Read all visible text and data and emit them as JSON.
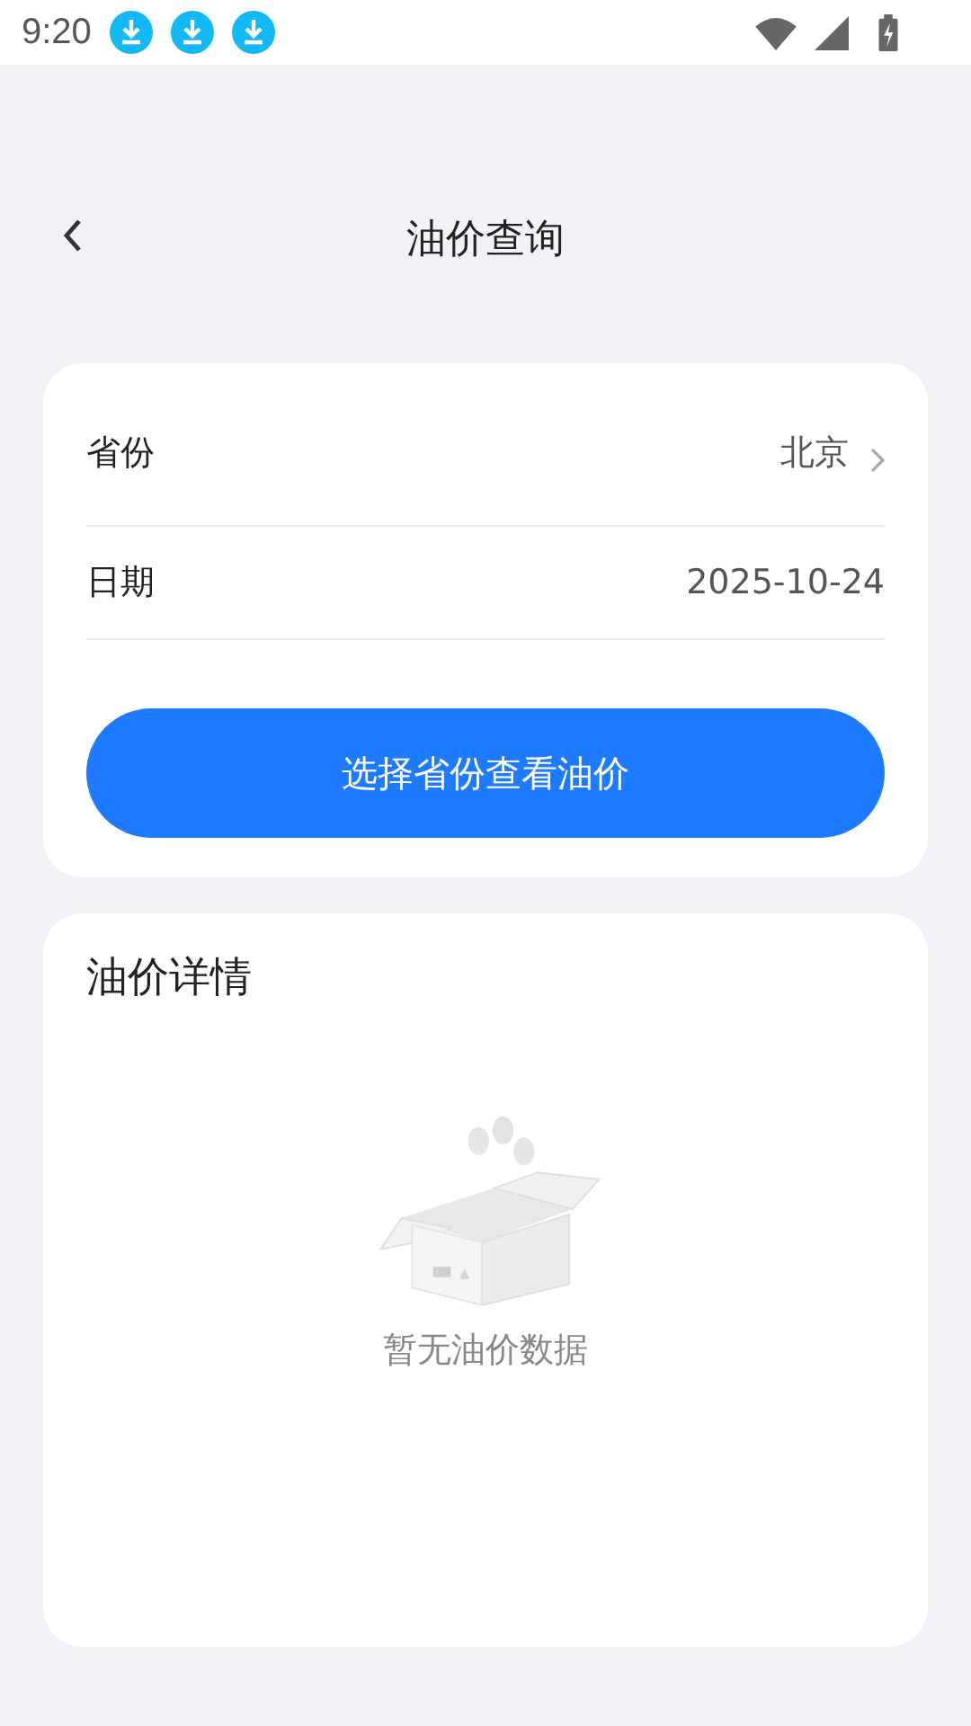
{
  "status_bar": {
    "time": "9:20"
  },
  "header": {
    "title": "油价查询"
  },
  "query_card": {
    "rows": [
      {
        "label": "省份",
        "value": "北京",
        "kind": "select"
      },
      {
        "label": "日期",
        "value": "2025-10-24",
        "kind": "text"
      }
    ],
    "button": "选择省份查看油价"
  },
  "details_card": {
    "title": "油价详情",
    "empty_text": "暂无油价数据"
  }
}
